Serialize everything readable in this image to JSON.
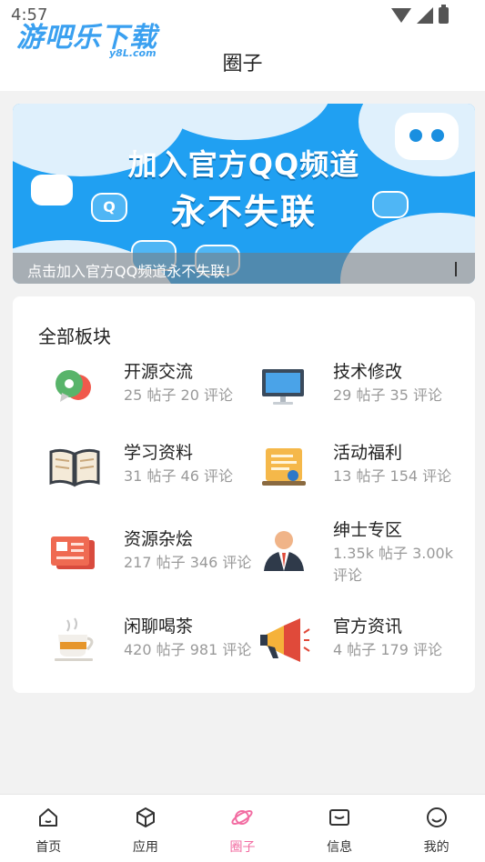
{
  "status_bar": {
    "time": "4:57"
  },
  "watermark": {
    "brand": "游吧乐下载",
    "domain": "y8L.com"
  },
  "header": {
    "title": "圈子"
  },
  "banner": {
    "line1": "加入官方QQ频道",
    "line2": "永不失联",
    "caption": "点击加入官方QQ频道永不失联!",
    "badge_q": "Q"
  },
  "sections": {
    "title": "全部板块",
    "items": [
      {
        "name": "开源交流",
        "stats": "25 帖子 20 评论",
        "icon": "chat-bubbles-icon"
      },
      {
        "name": "技术修改",
        "stats": "29 帖子 35 评论",
        "icon": "monitor-icon"
      },
      {
        "name": "学习资料",
        "stats": "31 帖子 46 评论",
        "icon": "open-book-icon"
      },
      {
        "name": "活动福利",
        "stats": "13 帖子 154 评论",
        "icon": "certificate-icon"
      },
      {
        "name": "资源杂烩",
        "stats": "217 帖子 346 评论",
        "icon": "red-card-icon"
      },
      {
        "name": "绅士专区",
        "stats": "1.35k 帖子 3.00k 评论",
        "icon": "gentleman-icon"
      },
      {
        "name": "闲聊喝茶",
        "stats": "420 帖子 981 评论",
        "icon": "tea-cup-icon"
      },
      {
        "name": "官方资讯",
        "stats": "4 帖子 179 评论",
        "icon": "megaphone-icon"
      }
    ]
  },
  "bottom_nav": {
    "items": [
      {
        "label": "首页",
        "icon": "home-icon"
      },
      {
        "label": "应用",
        "icon": "cube-icon"
      },
      {
        "label": "圈子",
        "icon": "planet-icon",
        "active": true
      },
      {
        "label": "信息",
        "icon": "mail-icon"
      },
      {
        "label": "我的",
        "icon": "smile-icon"
      }
    ]
  },
  "colors": {
    "accent": "#f26da2",
    "banner_blue": "#20a0f2"
  }
}
